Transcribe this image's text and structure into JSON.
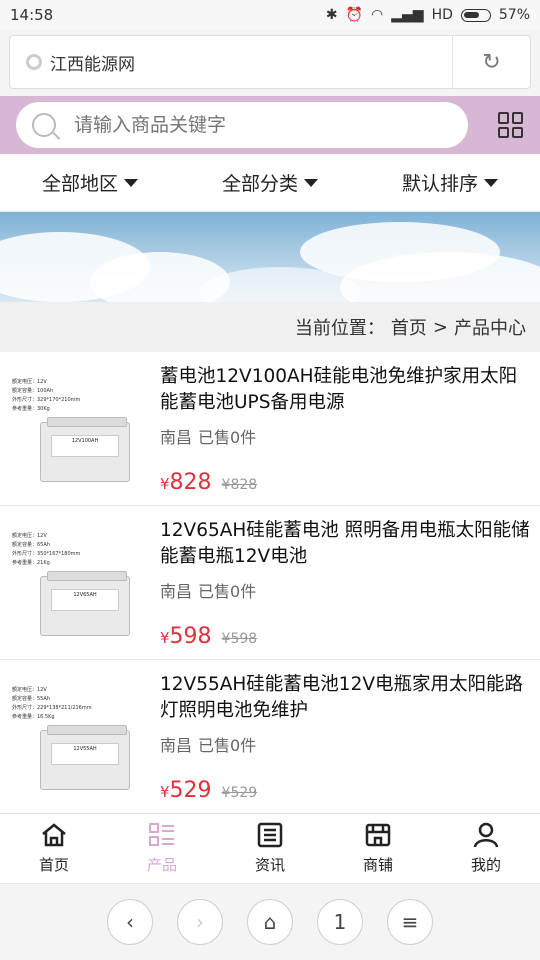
{
  "status": {
    "time": "14:58",
    "network": "HD",
    "battery": "57%"
  },
  "browser": {
    "url_title": "江西能源网"
  },
  "search": {
    "placeholder": "请输入商品关键字"
  },
  "filters": [
    "全部地区",
    "全部分类",
    "默认排序"
  ],
  "breadcrumb": {
    "prefix": "当前位置：",
    "home": "首页",
    "sep": ">",
    "current": "产品中心"
  },
  "products": [
    {
      "title": "蓄电池12V100AH硅能电池免维护家用太阳能蓄电池UPS备用电源",
      "location": "南昌",
      "sold": "已售0件",
      "currency": "¥",
      "price": "828",
      "old_price": "¥828",
      "image_label": "12V100AH",
      "spec": [
        "额定电压：12V",
        "额定容量：100Ah",
        "外形尺寸：329*170*210mm",
        "参考重量：30Kg"
      ]
    },
    {
      "title": "12V65AH硅能蓄电池 照明备用电瓶太阳能储能蓄电瓶12V电池",
      "location": "南昌",
      "sold": "已售0件",
      "currency": "¥",
      "price": "598",
      "old_price": "¥598",
      "image_label": "12V65AH",
      "spec": [
        "额定电压：12V",
        "额定容量：65Ah",
        "外形尺寸：350*167*180mm",
        "参考重量：21Kg"
      ]
    },
    {
      "title": "12V55AH硅能蓄电池12V电瓶家用太阳能路灯照明电池免维护",
      "location": "南昌",
      "sold": "已售0件",
      "currency": "¥",
      "price": "529",
      "old_price": "¥529",
      "image_label": "12V55AH",
      "spec": [
        "额定电压：12V",
        "额定容量：55Ah",
        "外形尺寸：229*138*211/216mm",
        "参考重量：16.5Kg"
      ]
    }
  ],
  "tabs": [
    {
      "label": "首页",
      "icon": "home-icon"
    },
    {
      "label": "产品",
      "icon": "list-icon",
      "active": true
    },
    {
      "label": "资讯",
      "icon": "news-icon"
    },
    {
      "label": "商铺",
      "icon": "store-icon"
    },
    {
      "label": "我的",
      "icon": "user-icon"
    }
  ],
  "nav": {
    "page_count": "1"
  },
  "colors": {
    "search_bg": "#d8b7d4",
    "price": "#e0303c",
    "active_tab": "#d8a8d0"
  }
}
